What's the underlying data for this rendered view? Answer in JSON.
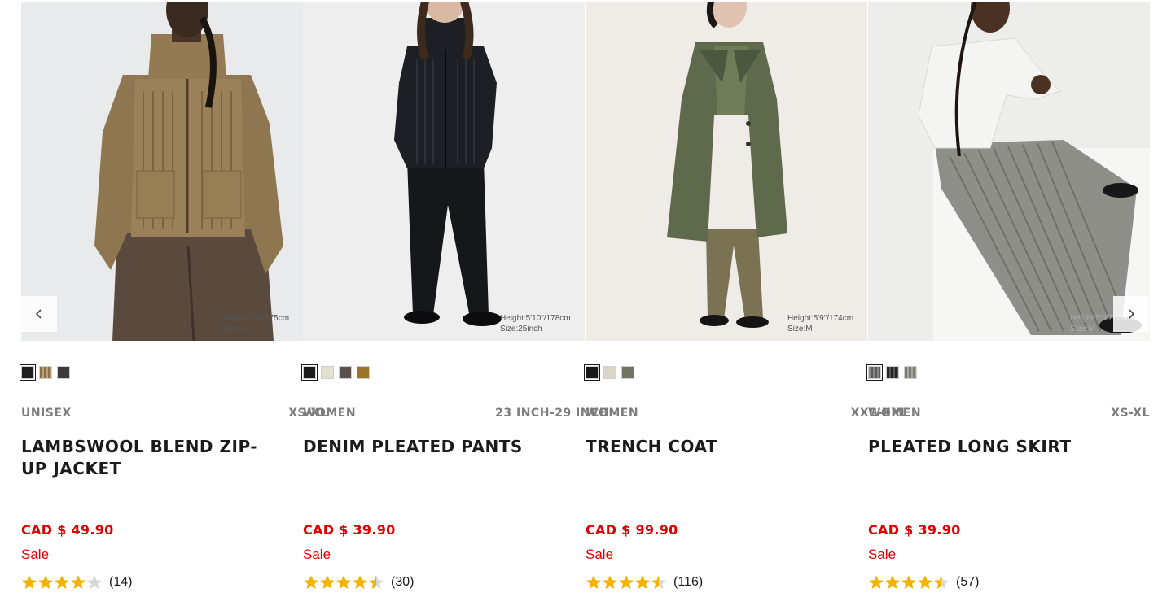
{
  "products": [
    {
      "name": "LAMBSWOOL BLEND ZIP-UP JACKET",
      "gender": "UNISEX",
      "size_range": "XS-XL",
      "price": "CAD $ 49.90",
      "sale_label": "Sale",
      "rating": 4,
      "review_count": "(14)",
      "photo_caption": [
        "Height:5'9\"/175cm",
        "Size:S"
      ],
      "swatches": [
        "#1e1e22",
        "#8c7048",
        "#3a3a3c"
      ],
      "image_desc": "model in olive ribbed zip-up cardigan, brown pants"
    },
    {
      "name": "DENIM PLEATED PANTS",
      "gender": "WOMEN",
      "size_range": "23 INCH-29 INCH",
      "price": "CAD $ 39.90",
      "sale_label": "Sale",
      "rating": 4.5,
      "review_count": "(30)",
      "photo_caption": [
        "Height:5'10\"/178cm",
        "Size:25inch"
      ],
      "swatches": [
        "#1a1a1f",
        "#e4dfd0",
        "#5a4f4b",
        "#9a7428"
      ],
      "image_desc": "model in black knit jacket and black pants"
    },
    {
      "name": "TRENCH COAT",
      "gender": "WOMEN",
      "size_range": "XXS-XXL",
      "price": "CAD $ 99.90",
      "sale_label": "Sale",
      "rating": 4.5,
      "review_count": "(116)",
      "photo_caption": [
        "Height:5'9\"/174cm",
        "Size:M"
      ],
      "swatches": [
        "#19191c",
        "#ddd6c7",
        "#6f7562"
      ],
      "image_desc": "model in olive trench coat"
    },
    {
      "name": "PLEATED LONG SKIRT",
      "gender": "WOMEN",
      "size_range": "XS-XL",
      "price": "CAD $ 39.90",
      "sale_label": "Sale",
      "rating": 4.5,
      "review_count": "(57)",
      "photo_caption": [
        "Height:5'9\"/176cm",
        "Size:M"
      ],
      "swatches": [
        "#8a8a8c",
        "#232325",
        "#7b7a72"
      ],
      "image_desc": "model seated in white sweater and grey pleated skirt"
    }
  ],
  "carousel": {
    "prev_icon": "chevron-left-icon",
    "next_icon": "chevron-right-icon"
  },
  "colors": {
    "price": "#e00000",
    "star": "#f0b400",
    "star_empty": "#d8d8d8"
  }
}
